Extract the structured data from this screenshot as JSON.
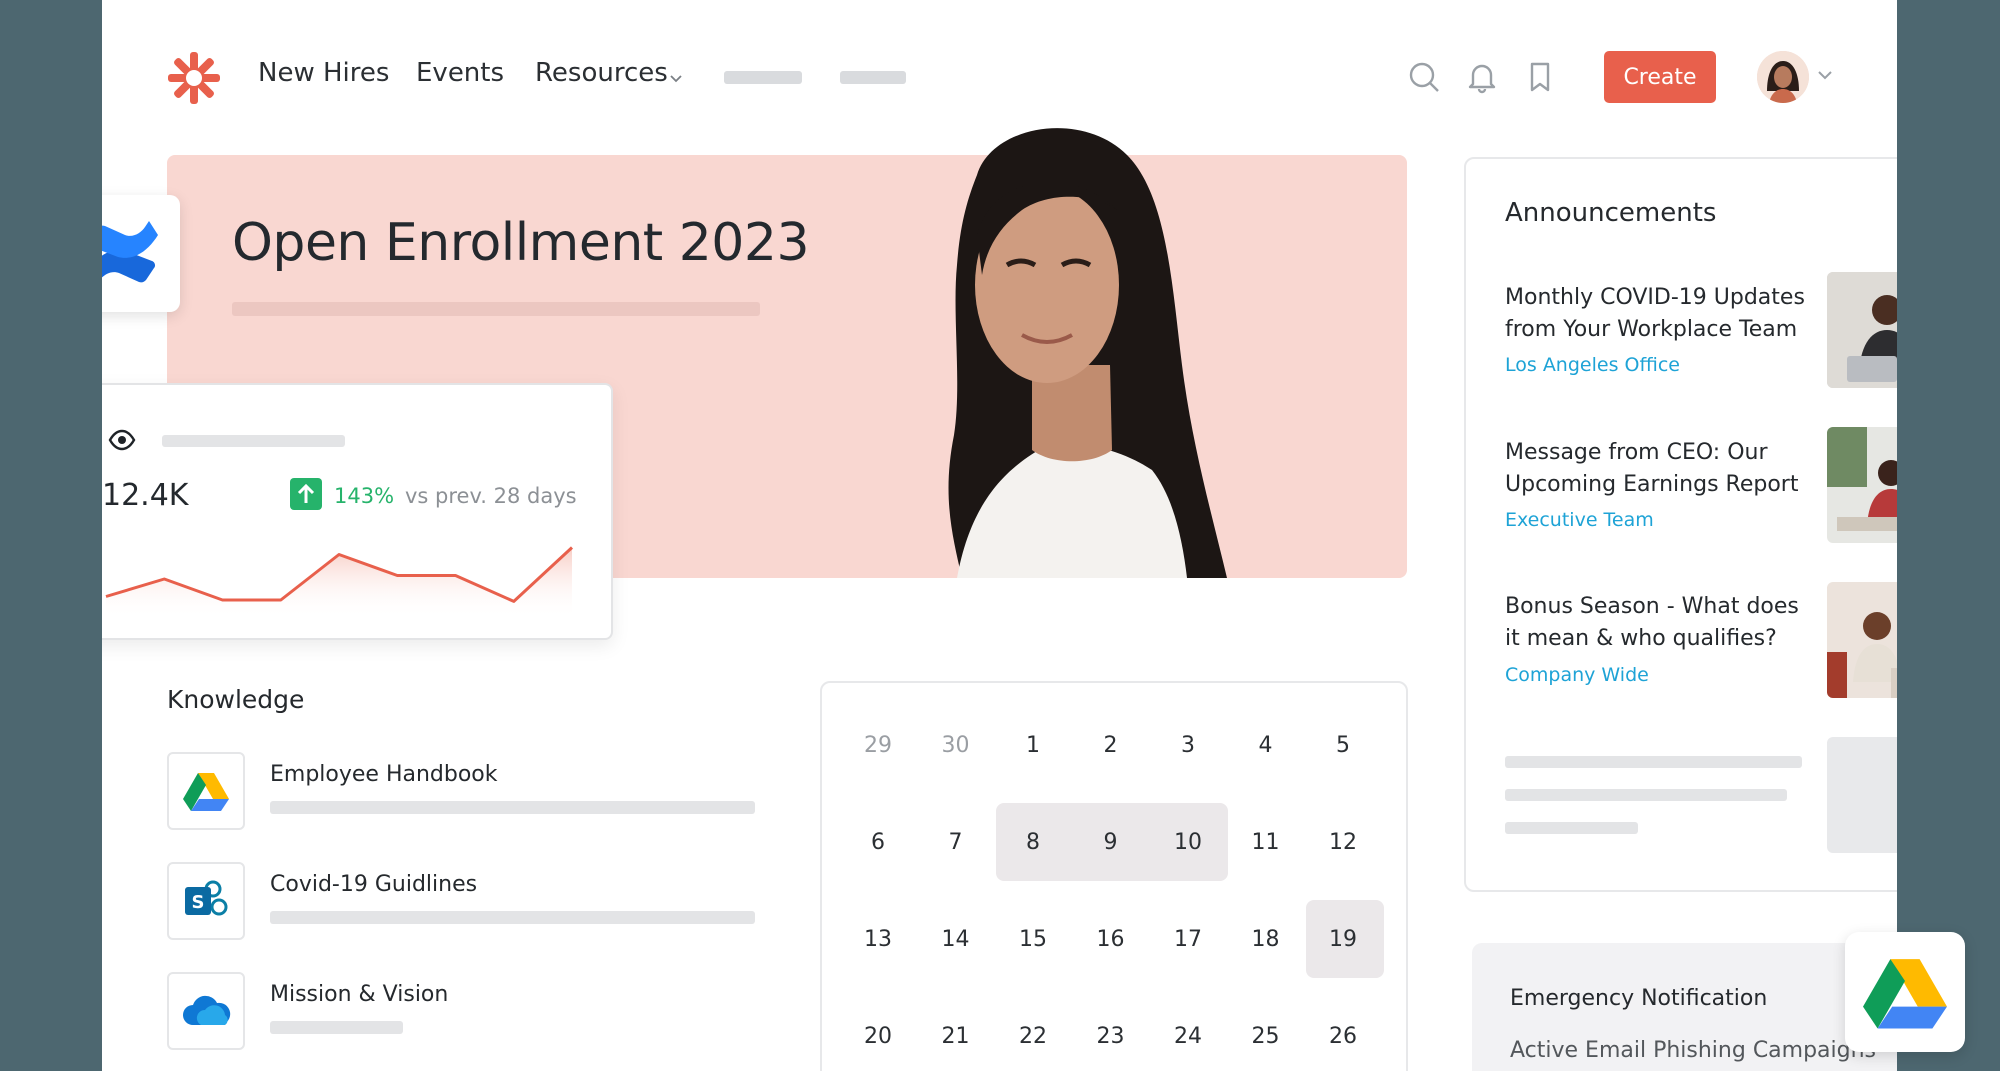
{
  "nav": {
    "links": [
      "New Hires",
      "Events",
      "Resources"
    ],
    "create_label": "Create"
  },
  "hero": {
    "title": "Open Enrollment 2023"
  },
  "stats": {
    "value": "12.4K",
    "change": "143%",
    "comparison": "vs prev. 28 days",
    "trend": [
      0.25,
      0.5,
      0.2,
      0.2,
      0.85,
      0.55,
      0.55,
      0.18,
      0.95
    ]
  },
  "announcements": {
    "title": "Announcements",
    "items": [
      {
        "title": "Monthly COVID-19 Updates from Your Workplace Team",
        "tag": "Los Angeles Office"
      },
      {
        "title": "Message from CEO: Our Upcoming Earnings Report",
        "tag": "Executive Team"
      },
      {
        "title": "Bonus Season - What does it mean & who qualifies?",
        "tag": "Company Wide"
      }
    ]
  },
  "emergency": {
    "title": "Emergency Notification",
    "subtitle": "Active Email Phishing Campaigns"
  },
  "knowledge": {
    "title": "Knowledge",
    "items": [
      {
        "label": "Employee Handbook",
        "icon": "google-drive-icon"
      },
      {
        "label": "Covid-19 Guidlines",
        "icon": "sharepoint-icon"
      },
      {
        "label": "Mission & Vision",
        "icon": "onedrive-icon"
      }
    ]
  },
  "calendar": {
    "rows": [
      [
        "29",
        "30",
        "1",
        "2",
        "3",
        "4",
        "5"
      ],
      [
        "6",
        "7",
        "8",
        "9",
        "10",
        "11",
        "12"
      ],
      [
        "13",
        "14",
        "15",
        "16",
        "17",
        "18",
        "19"
      ],
      [
        "20",
        "21",
        "22",
        "23",
        "24",
        "25",
        "26"
      ]
    ],
    "muted": [
      "29",
      "30"
    ],
    "range": [
      "8",
      "9",
      "10"
    ],
    "selected": "19"
  },
  "colors": {
    "accent": "#e8604c",
    "hero_bg": "#f9d7d1",
    "tag": "#1ea3d6",
    "positive": "#26b36b"
  }
}
